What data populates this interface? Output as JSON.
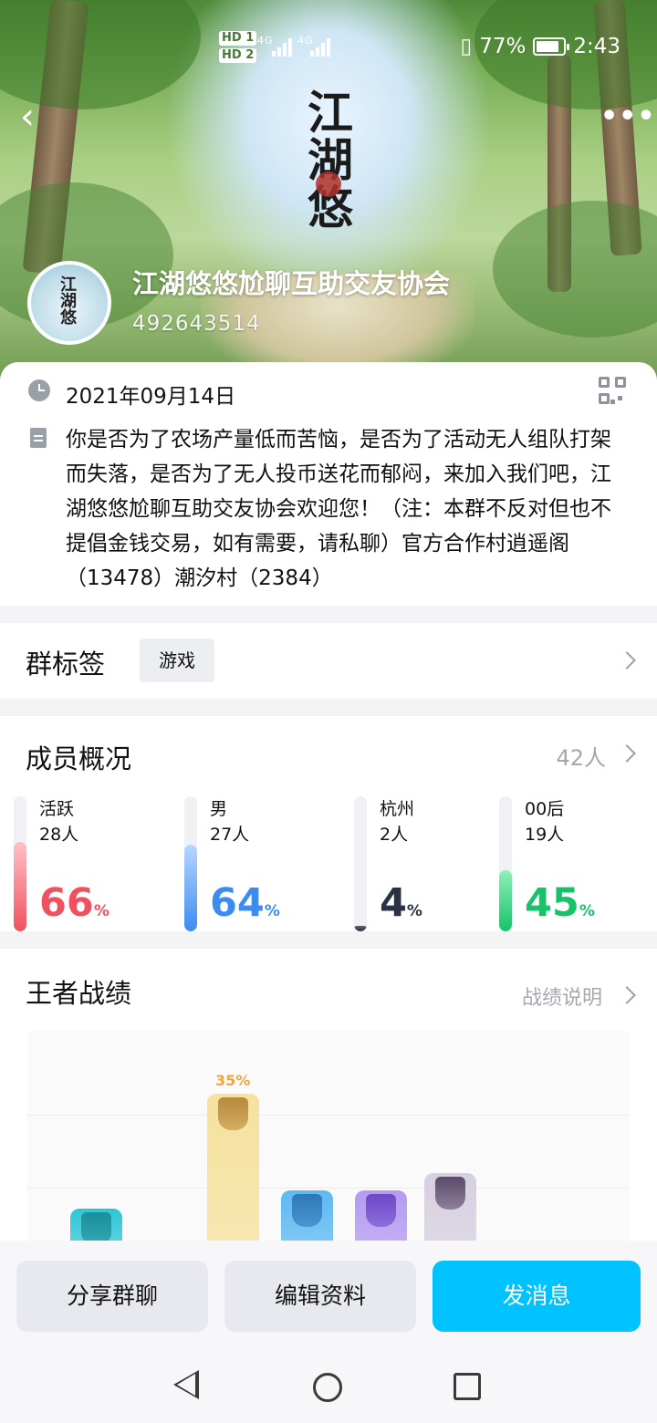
{
  "status_bar": {
    "hd1": "HD 1",
    "hd2": "HD 2",
    "net1": "4G",
    "net2": "4G",
    "battery": "77%",
    "time": "2:43"
  },
  "header": {
    "logo_text": [
      "江",
      "湖",
      "悠"
    ],
    "group_name": "江湖悠悠尬聊互助交友协会",
    "group_id": "492643514"
  },
  "info": {
    "date": "2021年09月14日",
    "description": "你是否为了农场产量低而苦恼，是否为了活动无人组队打架而失落，是否为了无人投币送花而郁闷，来加入我们吧，江湖悠悠尬聊互助交友协会欢迎您！（注：本群不反对但也不提倡金钱交易，如有需要，请私聊）官方合作村逍遥阁（13478）潮汐村（2384）"
  },
  "tags": {
    "title": "群标签",
    "items": [
      "游戏"
    ]
  },
  "members": {
    "title": "成员概况",
    "count": "42人",
    "stats": [
      {
        "label": "活跃",
        "sub": "28人",
        "percent": 66,
        "color": "#f0515e",
        "fill_top": "#ffc2c7"
      },
      {
        "label": "男",
        "sub": "27人",
        "percent": 64,
        "color": "#3c8cf0",
        "fill_top": "#b8d6ff"
      },
      {
        "label": "杭州",
        "sub": "2人",
        "percent": 4,
        "color": "#2b3245",
        "fill_top": "#5a6276"
      },
      {
        "label": "00后",
        "sub": "19人",
        "percent": 45,
        "color": "#17c36a",
        "fill_top": "#8ef0b8"
      }
    ],
    "percent_unit": "%"
  },
  "records": {
    "title": "王者战绩",
    "explain": "战绩说明",
    "highlight_label": "35%",
    "bars": [
      {
        "name": "rank-bar-1",
        "value": 0.15,
        "color": "#2fc6d6",
        "emblem": "#1d8e9b"
      },
      {
        "name": "rank-bar-2",
        "value": 0.7,
        "color": "#f6e19e",
        "emblem": "#b88a3a"
      },
      {
        "name": "rank-bar-3",
        "value": 0.24,
        "color": "#5db9f3",
        "emblem": "#2f78b8"
      },
      {
        "name": "rank-bar-4",
        "value": 0.24,
        "color": "#b49af2",
        "emblem": "#6d49c8"
      },
      {
        "name": "rank-bar-5",
        "value": 0.32,
        "color": "#d6cfe0",
        "emblem": "#5b4a6a"
      }
    ]
  },
  "actions": {
    "share": "分享群聊",
    "edit": "编辑资料",
    "send": "发消息"
  },
  "colors": {
    "primary": "#00c2ff"
  }
}
